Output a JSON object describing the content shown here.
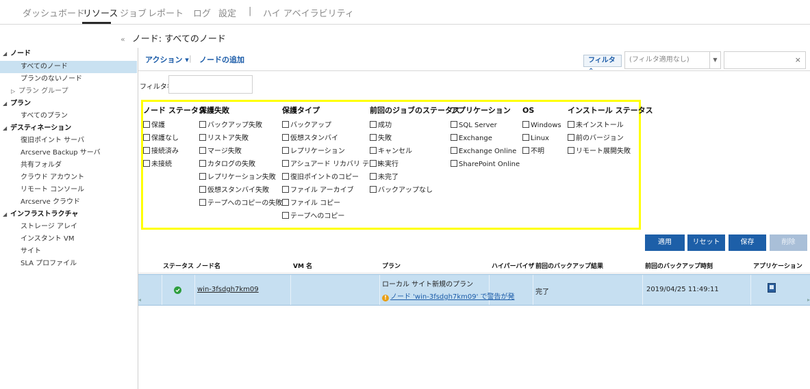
{
  "topnav": {
    "items": [
      "ダッシュボード",
      "リソース",
      "ジョブ",
      "レポート",
      "ログ",
      "設定",
      "|",
      "ハイ アベイラビリティ"
    ]
  },
  "breadcrumb": {
    "collapse": "«",
    "title": "ノード: すべてのノード"
  },
  "sidebar": {
    "nodes": "ノード",
    "all_nodes": "すべてのノード",
    "no_plan_nodes": "プランのないノード",
    "plan_groups": "プラン グループ",
    "plans": "プラン",
    "all_plans": "すべてのプラン",
    "destinations": "デスティネーション",
    "rps": "復旧ポイント サーバ",
    "arcserve_backup": "Arcserve Backup サーバ",
    "shared_folder": "共有フォルダ",
    "cloud_account": "クラウド アカウント",
    "remote_console": "リモート コンソール",
    "arcserve_cloud": "Arcserve クラウド",
    "infrastructure": "インフラストラクチャ",
    "storage_array": "ストレージ アレイ",
    "instant_vm": "インスタント VM",
    "site": "サイト",
    "sla_profile": "SLA プロファイル"
  },
  "toolbar": {
    "action": "アクション ▾",
    "separator": "|",
    "add_node": "ノードの追加",
    "filter": "フィルタ ⌃",
    "filter_select": "(フィルタ適用なし)",
    "clear": "×"
  },
  "filter_name": {
    "label": "フィルタ名",
    "value": ""
  },
  "filter_panel": {
    "columns": [
      {
        "header": "ノード ステータス",
        "options": [
          "保護",
          "保護なし",
          "接続済み",
          "未接続"
        ]
      },
      {
        "header": "保護失敗",
        "options": [
          "バックアップ失敗",
          "リストア失敗",
          "マージ失敗",
          "カタログの失敗",
          "レプリケーション失敗",
          "仮想スタンバイ失敗",
          "テープへのコピーの失敗"
        ]
      },
      {
        "header": "保護タイプ",
        "options": [
          "バックアップ",
          "仮想スタンバイ",
          "レプリケーション",
          "アシュアード リカバリ テスト",
          "復旧ポイントのコピー",
          "ファイル アーカイブ",
          "ファイル コピー",
          "テープへのコピー"
        ]
      },
      {
        "header": "前回のジョブのステータス",
        "options": [
          "成功",
          "失敗",
          "キャンセル",
          "未実行",
          "未完了",
          "バックアップなし"
        ]
      },
      {
        "header": "アプリケーション",
        "options": [
          "SQL Server",
          "Exchange",
          "Exchange Online",
          "SharePoint Online"
        ]
      },
      {
        "header": "OS",
        "options": [
          "Windows",
          "Linux",
          "不明"
        ]
      },
      {
        "header": "インストール ステータス",
        "options": [
          "未インストール",
          "前のバージョン",
          "リモート展開失敗"
        ]
      }
    ]
  },
  "buttons": {
    "apply": "適用",
    "reset": "リセット",
    "save": "保存",
    "delete": "削除"
  },
  "table": {
    "headers": {
      "status": "ステータス",
      "node_name": "ノード名",
      "vm_name": "VM 名",
      "plan": "プラン",
      "hypervisor": "ハイパーバイザ",
      "last_result": "前回のバックアップ結果",
      "last_time": "前回のバックアップ時刻",
      "application": "アプリケーション"
    },
    "rows": [
      {
        "node_name": "win-3fsdgh7km09",
        "plan": "ローカル サイト新規のプラン",
        "warning": "ノード 'win-3fsdgh7km09' で警告が発",
        "result": "完了",
        "time": "2019/04/25 11:49:11"
      }
    ]
  },
  "colors": {
    "accent": "#1d5fa8",
    "highlight": "#ffff00",
    "selected_row": "#c6dff1",
    "status_ok": "#2e9e3e"
  }
}
